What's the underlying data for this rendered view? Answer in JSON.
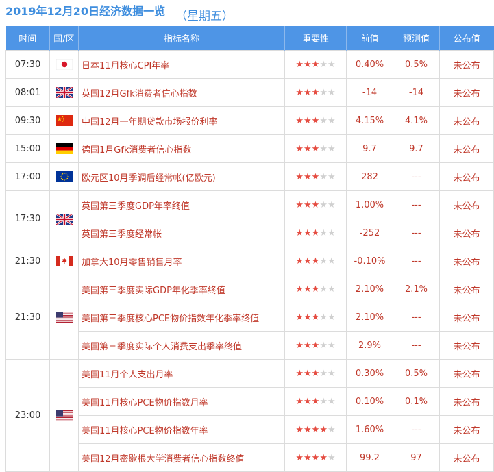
{
  "header": {
    "date_title": "2019年12月20日经济数据一览",
    "weekday": "（星期五）"
  },
  "columns": [
    "时间",
    "国/区",
    "指标名称",
    "重要性",
    "前值",
    "预测值",
    "公布值"
  ],
  "rows": [
    {
      "time": "07:30",
      "flag": "japan-flag",
      "name": "日本11月核心CPI年率",
      "stars": 3,
      "prev": "0.40%",
      "forecast": "0.5%",
      "actual": "未公布"
    },
    {
      "time": "08:01",
      "flag": "uk-flag",
      "name": "英国12月Gfk消费者信心指数",
      "stars": 3,
      "prev": "-14",
      "forecast": "-14",
      "actual": "未公布"
    },
    {
      "time": "09:30",
      "flag": "china-flag",
      "name": "中国12月一年期贷款市场报价利率",
      "stars": 3,
      "prev": "4.15%",
      "forecast": "4.1%",
      "actual": "未公布"
    },
    {
      "time": "15:00",
      "flag": "germany-flag",
      "name": "德国1月Gfk消费者信心指数",
      "stars": 3,
      "prev": "9.7",
      "forecast": "9.7",
      "actual": "未公布"
    },
    {
      "time": "17:00",
      "flag": "eu-flag",
      "name": "欧元区10月季调后经常帐(亿欧元)",
      "stars": 3,
      "prev": "282",
      "forecast": "---",
      "actual": "未公布"
    },
    {
      "time": "17:30",
      "flag": "uk-flag",
      "name": "英国第三季度GDP年率终值",
      "stars": 3,
      "prev": "1.00%",
      "forecast": "---",
      "actual": "未公布"
    },
    {
      "time": "",
      "flag": "",
      "name": "英国第三季度经常帐",
      "stars": 3,
      "prev": "-252",
      "forecast": "---",
      "actual": "未公布"
    },
    {
      "time": "21:30",
      "flag": "canada-flag",
      "name": "加拿大10月零售销售月率",
      "stars": 3,
      "prev": "-0.10%",
      "forecast": "---",
      "actual": "未公布"
    },
    {
      "time": "21:30",
      "flag": "us-flag",
      "name": "美国第三季度实际GDP年化季率终值",
      "stars": 3,
      "prev": "2.10%",
      "forecast": "2.1%",
      "actual": "未公布"
    },
    {
      "time": "",
      "flag": "",
      "name": "美国第三季度核心PCE物价指数年化季率终值",
      "stars": 3,
      "prev": "2.10%",
      "forecast": "---",
      "actual": "未公布"
    },
    {
      "time": "",
      "flag": "",
      "name": "美国第三季度实际个人消费支出季率终值",
      "stars": 3,
      "prev": "2.9%",
      "forecast": "---",
      "actual": "未公布"
    },
    {
      "time": "23:00",
      "flag": "us-flag",
      "name": "美国11月个人支出月率",
      "stars": 3,
      "prev": "0.30%",
      "forecast": "0.5%",
      "actual": "未公布"
    },
    {
      "time": "",
      "flag": "",
      "name": "美国11月核心PCE物价指数月率",
      "stars": 3,
      "prev": "0.10%",
      "forecast": "0.1%",
      "actual": "未公布"
    },
    {
      "time": "",
      "flag": "",
      "name": "美国11月核心PCE物价指数年率",
      "stars": 4,
      "prev": "1.60%",
      "forecast": "---",
      "actual": "未公布"
    },
    {
      "time": "",
      "flag": "",
      "name": "美国12月密歇根大学消费者信心指数终值",
      "stars": 4,
      "prev": "99.2",
      "forecast": "97",
      "actual": "未公布"
    }
  ],
  "star_max": 5
}
